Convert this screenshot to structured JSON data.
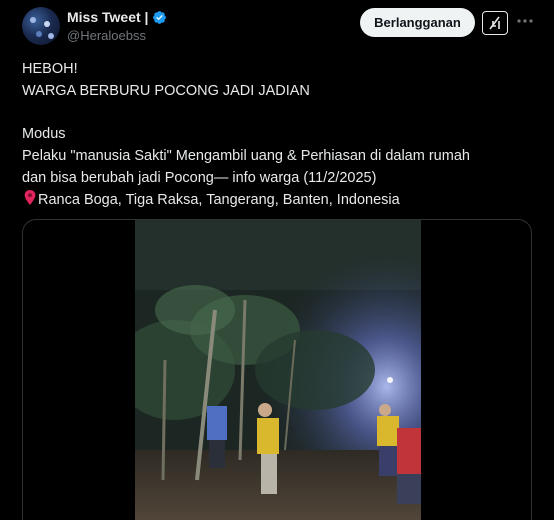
{
  "author": {
    "name": "Miss Tweet |",
    "handle": "@Heraloebss",
    "avatar_icon": "avatar-image",
    "verified_icon": "verified-badge-icon"
  },
  "actions": {
    "subscribe_label": "Berlangganan",
    "grok_icon": "grok-icon",
    "more_icon": "more-icon"
  },
  "tweet": {
    "line1": "HEBOH!",
    "line2": "WARGA BERBURU POCONG JADI JADIAN",
    "line3": "Modus",
    "line4": "Pelaku \"manusia Sakti\" Mengambil uang & Perhiasan di dalam rumah",
    "line5": "dan bisa berubah jadi Pocong— info warga (11/2/2025)",
    "location_icon": "pin-icon",
    "location": "Ranca Boga, Tiga Raksa, Tangerang, Banten, Indonesia"
  },
  "media": {
    "type": "video",
    "description_icon": "video-thumbnail"
  },
  "colors": {
    "background": "#000000",
    "text": "#e7e9ea",
    "secondary": "#71767b",
    "verified": "#1d9bf0",
    "button_bg": "#eff3f4"
  }
}
